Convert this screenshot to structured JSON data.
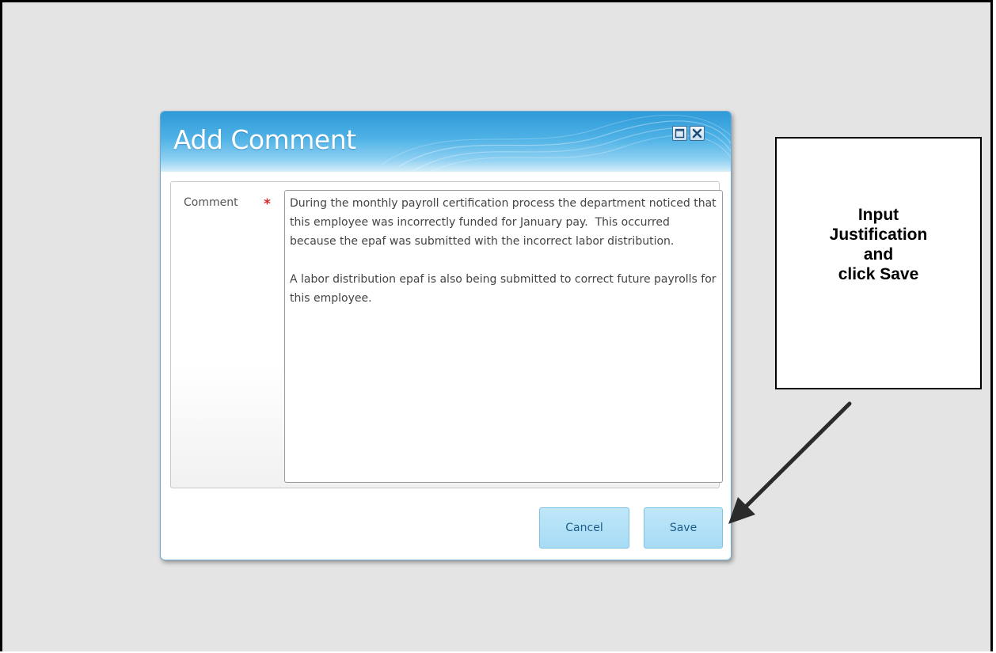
{
  "dialog": {
    "title": "Add Comment",
    "maximize_icon": "maximize-icon",
    "close_icon": "close-icon",
    "title_gradient": [
      "#2e9ad8",
      "#d6eef9"
    ]
  },
  "form": {
    "comment_label": "Comment",
    "required_marker": "*",
    "comment_value": "During the monthly payroll certification process the department noticed that this employee was incorrectly funded for January pay.  This occurred because the epaf was submitted with the incorrect labor distribution.\n\nA labor distribution epaf is also being submitted to correct future payrolls for this employee."
  },
  "buttons": {
    "cancel_label": "Cancel",
    "save_label": "Save"
  },
  "annotation": {
    "lines": [
      "Input",
      "Justification",
      "and",
      "click Save"
    ]
  }
}
